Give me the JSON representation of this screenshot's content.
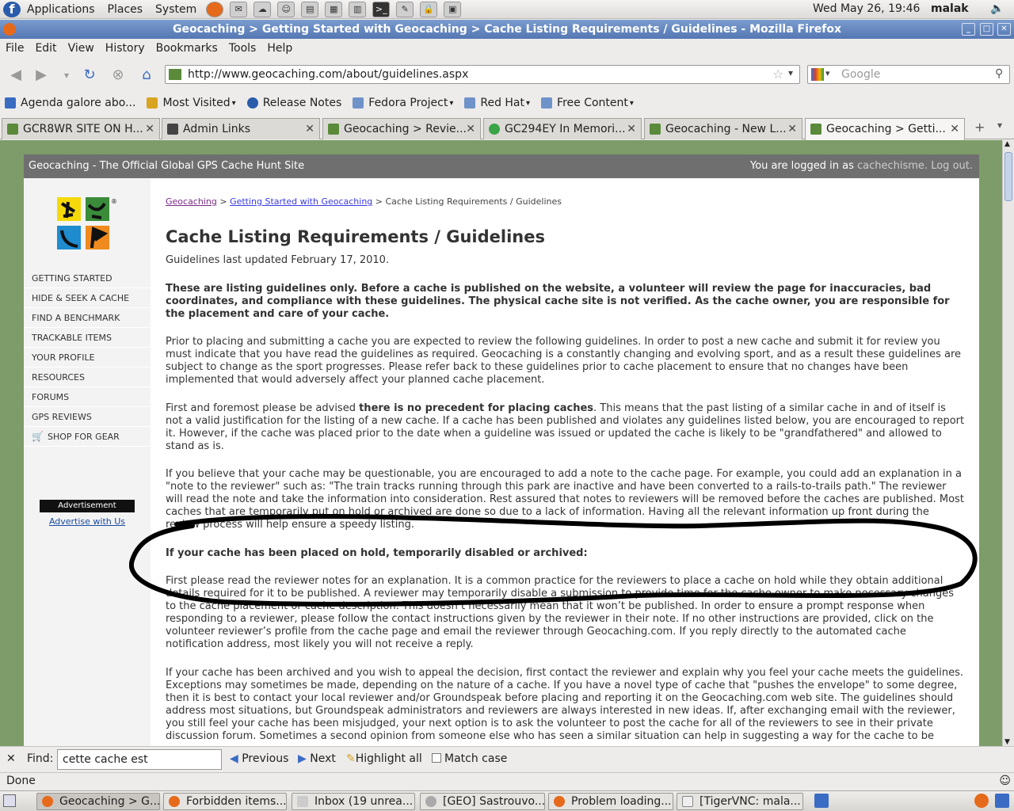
{
  "panel": {
    "menus": [
      "Applications",
      "Places",
      "System"
    ],
    "clock": "Wed May 26, 19:46",
    "user": "malak"
  },
  "window": {
    "title": "Geocaching > Getting Started with Geocaching > Cache Listing Requirements / Guidelines - Mozilla Firefox"
  },
  "menubar": [
    "File",
    "Edit",
    "View",
    "History",
    "Bookmarks",
    "Tools",
    "Help"
  ],
  "navbar": {
    "url": "http://www.geocaching.com/about/guidelines.aspx",
    "search_placeholder": "Google"
  },
  "bookmarks": [
    {
      "label": "Agenda galore abo...",
      "dropdown": false
    },
    {
      "label": "Most Visited",
      "dropdown": true
    },
    {
      "label": "Release Notes",
      "dropdown": false
    },
    {
      "label": "Fedora Project",
      "dropdown": true
    },
    {
      "label": "Red Hat",
      "dropdown": true
    },
    {
      "label": "Free Content",
      "dropdown": true
    }
  ],
  "tabs": [
    {
      "label": "GCR8WR SITE ON H..."
    },
    {
      "label": "Admin Links"
    },
    {
      "label": "Geocaching > Revie..."
    },
    {
      "label": "GC294EY In Memori..."
    },
    {
      "label": "Geocaching - New L..."
    },
    {
      "label": "Geocaching > Getti..."
    }
  ],
  "site": {
    "header_title": "Geocaching - The Official Global GPS Cache Hunt Site",
    "logged_in_prefix": "You are logged in as",
    "username": "cachechisme.",
    "logout": "Log out.",
    "nav": [
      "Getting Started",
      "Hide & Seek a Cache",
      "Find a Benchmark",
      "Trackable Items",
      "Your Profile",
      "Resources",
      "Forums",
      "GPS Reviews",
      "Shop for Gear"
    ],
    "ad_label": "Advertisement",
    "ad_link": "Advertise with Us",
    "breadcrumb": {
      "home": "Geocaching",
      "sep1": ">",
      "parent": "Getting Started with Geocaching",
      "sep2": ">",
      "current": "Cache Listing Requirements / Guidelines"
    },
    "title": "Cache Listing Requirements / Guidelines",
    "updated": "Guidelines last updated February 17, 2010.",
    "intro_bold": "These are listing guidelines only. Before a cache is published on the website, a volunteer will review the page for inaccuracies, bad coordinates, and compliance with these guidelines. The physical cache site is not verified. As the cache owner, you are responsible for the placement and care of your cache.",
    "para1": "Prior to placing and submitting a cache you are expected to review the following guidelines. In order to post a new cache and submit it for review you must indicate that you have read the guidelines as required. Geocaching is a constantly changing and evolving sport, and as a result these guidelines are subject to change as the sport progresses. Please refer back to these guidelines prior to cache placement to ensure that no changes have been implemented that would adversely affect your planned cache placement.",
    "para2_pre": "First and foremost please be advised ",
    "para2_bold": "there is no precedent for placing caches",
    "para2_post": ". This means that the past listing of a similar cache in and of itself is not a valid justification for the listing of a new cache. If a cache has been published and violates any guidelines listed below, you are encouraged to report it. However, if the cache was placed prior to the date when a guideline was issued or updated the cache is likely to be \"grandfathered\" and allowed to stand as is.",
    "para3": "If you believe that your cache may be questionable, you are encouraged to add a note to the cache page. For example, you could add an explanation in a \"note to the reviewer\" such as: \"The train tracks running through this park are inactive and have been converted to a rails-to-trails path.\" The reviewer will read the note and take the information into consideration. Rest assured that notes to reviewers will be removed before the caches are published. Most caches that are temporarily put on hold or archived are done so due to a lack of information. Having all the relevant information up front during the review process will help ensure a speedy listing.",
    "subhead": "If your cache has been placed on hold, temporarily disabled or archived:",
    "para4": "First please read the reviewer notes for an explanation. It is a common practice for the reviewers to place a cache on hold while they obtain additional details required for it to be published. A reviewer may temporarily disable a submission to provide time for the cache owner to make necessary changes to the cache placement or cache description. This doesn’t necessarily mean that it won’t be published. In order to ensure a prompt response when responding to a reviewer, please follow the contact instructions given by the reviewer in their note. If no other instructions are provided, click on the volunteer reviewer’s profile from the cache page and email the reviewer through Geocaching.com. If you reply directly to the automated cache notification address, most likely you will not receive a reply.",
    "para5": "If your cache has been archived and you wish to appeal the decision, first contact the reviewer and explain why you feel your cache meets the guidelines. Exceptions may sometimes be made, depending on the nature of a cache. If you have a novel type of cache that \"pushes the envelope\" to some degree, then it is best to contact your local reviewer and/or Groundspeak before placing and reporting it on the Geocaching.com web site. The guidelines should address most situations, but Groundspeak administrators and reviewers are always interested in new ideas. If, after exchanging email with the reviewer, you still feel your cache has been misjudged, your next option is to ask the volunteer to post the cache for all of the reviewers to see in their private discussion forum. Sometimes a second opinion from someone else who has seen a similar situation can help in suggesting a way for the cache to be"
  },
  "findbar": {
    "label": "Find:",
    "value": "cette cache est",
    "previous": "Previous",
    "next": "Next",
    "highlight": "Highlight all",
    "match_case": "Match case"
  },
  "status": "Done",
  "taskbar": [
    {
      "label": "Geocaching > G...",
      "active": true
    },
    {
      "label": "Forbidden items...",
      "active": false
    },
    {
      "label": "Inbox (19 unrea...",
      "active": false
    },
    {
      "label": "[GEO] Sastrouvo...",
      "active": false
    },
    {
      "label": "Problem loading...",
      "active": false
    },
    {
      "label": "[TigerVNC: mala...",
      "active": false
    }
  ],
  "colors": {
    "titlebar": "#5a7bb5",
    "page_bg": "#7d9c69",
    "header_gray": "#6f6f6f",
    "link": "#3b3be0"
  }
}
